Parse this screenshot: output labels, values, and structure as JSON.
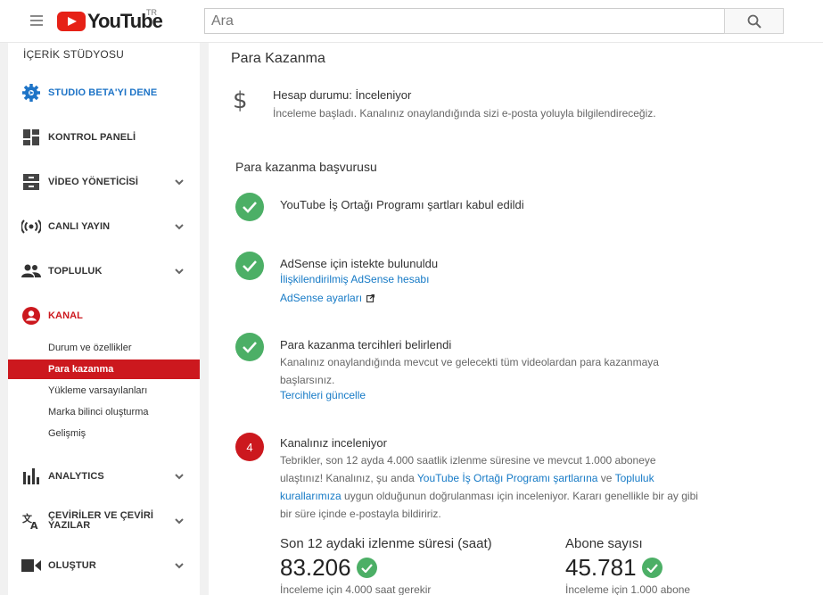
{
  "header": {
    "logo_text": "YouTube",
    "region": "TR",
    "search_placeholder": "Ara",
    "icons": [
      "menu-icon",
      "search-icon"
    ]
  },
  "sidebar": {
    "title": "İÇERİK STÜDYOSU",
    "items": [
      {
        "label": "STUDIO BETA'YI DENE",
        "icon": "gear-icon",
        "highlight": true
      },
      {
        "label": "KONTROL PANELİ",
        "icon": "dashboard-icon"
      },
      {
        "label": "VİDEO YÖNETİCİSİ",
        "icon": "video-manager-icon"
      },
      {
        "label": "CANLI YAYIN",
        "icon": "live-icon"
      },
      {
        "label": "TOPLULUK",
        "icon": "community-icon"
      },
      {
        "label": "KANAL",
        "icon": "channel-icon",
        "active": true
      },
      {
        "label": "ANALYTICS",
        "icon": "analytics-icon"
      },
      {
        "label": "ÇEVİRİLER VE ÇEVİRİ YAZILAR",
        "icon": "translate-icon"
      },
      {
        "label": "OLUŞTUR",
        "icon": "create-icon"
      }
    ],
    "channel_sub_items": [
      {
        "label": "Durum ve özellikler"
      },
      {
        "label": "Para kazanma",
        "active": true
      },
      {
        "label": "Yükleme varsayılanları"
      },
      {
        "label": "Marka bilinci oluşturma"
      },
      {
        "label": "Gelişmiş"
      }
    ]
  },
  "main": {
    "title": "Para Kazanma",
    "account": {
      "status": "Hesap durumu: İnceleniyor",
      "description": "İnceleme başladı. Kanalınız onaylandığında sizi e-posta yoluyla bilgilendireceğiz."
    },
    "section_title": "Para kazanma başvurusu",
    "steps": [
      {
        "title": "YouTube İş Ortağı Programı şartları kabul edildi"
      },
      {
        "title": "AdSense için istekte bulunuldu",
        "link1": "İlişkilendirilmiş AdSense hesabı",
        "link2": "AdSense ayarları"
      },
      {
        "title": "Para kazanma tercihleri belirlendi",
        "text": "Kanalınız onaylandığında mevcut ve gelecekti tüm videolardan para kazanmaya başlarsınız.",
        "link": "Tercihleri güncelle"
      },
      {
        "number": "4",
        "title": "Kanalınız inceleniyor",
        "text_a": "Tebrikler, son 12 ayda 4.000 saatlik izlenme süresine ve mevcut 1.000 aboneye ulaştınız! Kanalınız, şu anda ",
        "link_a": "YouTube İş Ortağı Programı şartlarına",
        "text_b": " ve ",
        "link_b": "Topluluk kurallarımıza",
        "text_c": " uygun olduğunun doğrulanması için inceleniyor. Kararı genellikle bir ay gibi bir süre içinde e-postayla bildiririz."
      }
    ],
    "stats": [
      {
        "label": "Son 12 aydaki izlenme süresi (saat)",
        "value": "83.206",
        "note": "İnceleme için 4.000 saat gerekir"
      },
      {
        "label": "Abone sayısı",
        "value": "45.781",
        "note": "İnceleme için 1.000 abone"
      }
    ]
  },
  "colors": {
    "brand_red": "#cc181e",
    "link_blue": "#167ac6",
    "success_green": "#4caf66"
  }
}
